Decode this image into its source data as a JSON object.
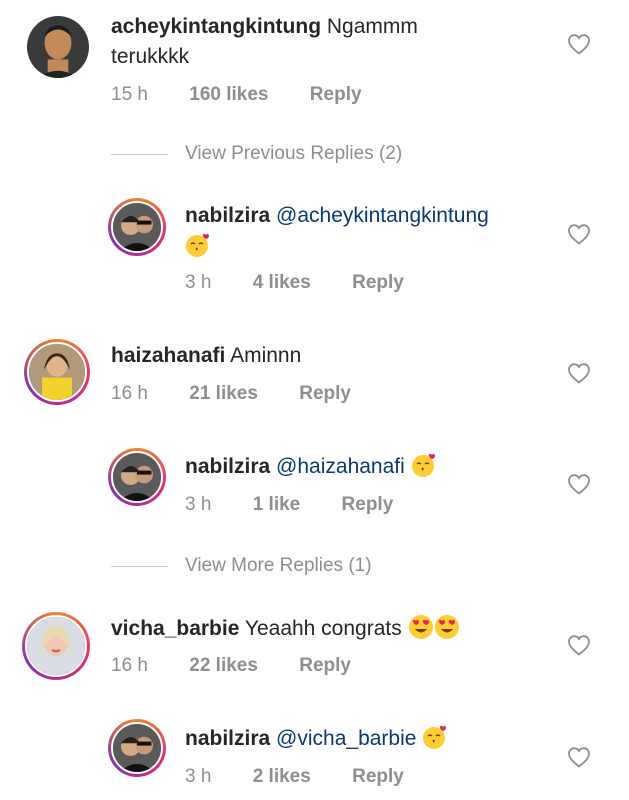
{
  "comments": [
    {
      "username": "acheykintangkintung",
      "text_line1": "Ngammm",
      "text_line2": "terukkkk",
      "time": "15 h",
      "likes": "160 likes",
      "reply": "Reply"
    },
    {
      "username": "nabilzira",
      "mention": "@acheykintangkintung",
      "time": "3 h",
      "likes": "4 likes",
      "reply": "Reply"
    },
    {
      "username": "haizahanafi",
      "text": "Aminnn",
      "time": "16 h",
      "likes": "21 likes",
      "reply": "Reply"
    },
    {
      "username": "nabilzira",
      "mention": "@haizahanafi",
      "time": "3 h",
      "likes": "1 like",
      "reply": "Reply"
    },
    {
      "username": "vicha_barbie",
      "text": "Yeaahh congrats",
      "time": "16 h",
      "likes": "22 likes",
      "reply": "Reply"
    },
    {
      "username": "nabilzira",
      "mention": "@vicha_barbie",
      "time": "3 h",
      "likes": "2 likes",
      "reply": "Reply"
    }
  ],
  "view_previous": "View Previous Replies (2)",
  "view_more": "View More Replies (1)",
  "icons": {
    "like": "heart-outline-icon",
    "kiss": "kissing-face-emoji",
    "love": "heart-eyes-emoji"
  },
  "colors": {
    "mention": "#0b3870",
    "meta": "#8e8e8e",
    "text": "#262626"
  }
}
